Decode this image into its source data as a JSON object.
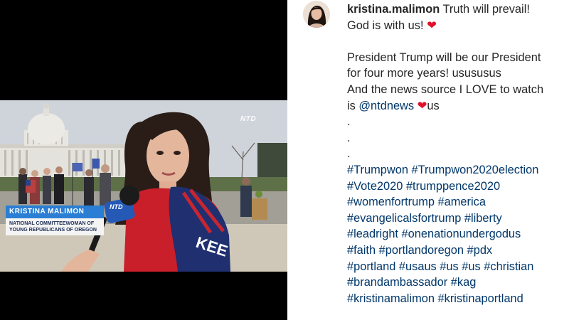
{
  "video": {
    "overlay_name": "KRISTINA MALIMON",
    "overlay_title_line1": "NATIONAL COMMITTEEWOMAN OF",
    "overlay_title_line2": "YOUNG REPUBLICANS OF OREGON",
    "channel_logo": "NTD",
    "mic_label": "NTD",
    "flag_text": "KEE",
    "colors": {
      "lower_third_bar": "#2a7fd4",
      "lower_third_sub": "#f4f4f4"
    }
  },
  "post": {
    "avatar_icon": "profile-avatar",
    "username": "kristina.malimon",
    "line1": "Truth will prevail!",
    "line2": "God is with us!",
    "heart_1": "❤",
    "paragraph_line1": "President Trump will be our President",
    "paragraph_line2": "for four more years! usususus",
    "paragraph_line3": "And the news source I LOVE to watch",
    "paragraph_line4_prefix": "is",
    "mention": "@ntdnews",
    "heart_2": "❤",
    "paragraph_line4_suffix": "us",
    "dots": [
      ".",
      ".",
      "."
    ],
    "hashtag_lines": [
      "#Trumpwon #Trumpwon2020election",
      "#Vote2020 #trumppence2020",
      "#womenfortrump #america",
      "#evangelicalsfortrump #liberty",
      "#leadright #onenationundergodus",
      "#faith #portlandoregon #pdx",
      "#portland #usaus #us #us #christian",
      "#brandambassador #kag",
      "#kristinamalimon #kristinaportland"
    ],
    "colors": {
      "link": "#00376b",
      "text": "#262626",
      "heart": "#e0112b"
    }
  }
}
